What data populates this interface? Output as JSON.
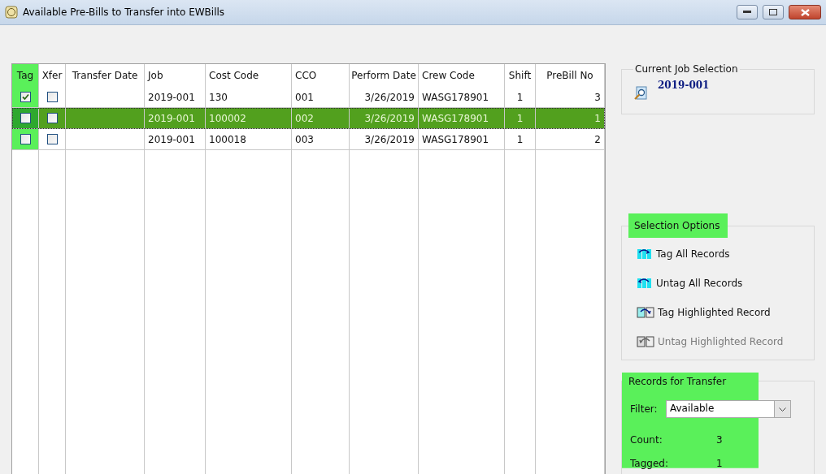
{
  "window": {
    "title": "Available Pre-Bills to Transfer into EWBills"
  },
  "grid": {
    "columns": [
      {
        "label": "Tag",
        "highlighted": true
      },
      {
        "label": "Xfer",
        "highlighted": false
      },
      {
        "label": "Transfer Date",
        "highlighted": false
      },
      {
        "label": "Job",
        "highlighted": false
      },
      {
        "label": "Cost Code",
        "highlighted": false
      },
      {
        "label": "CCO",
        "highlighted": false
      },
      {
        "label": "Perform Date",
        "highlighted": false
      },
      {
        "label": "Crew Code",
        "highlighted": false
      },
      {
        "label": "Shift",
        "highlighted": false
      },
      {
        "label": "PreBill No",
        "highlighted": false
      }
    ],
    "rows": [
      {
        "tag": true,
        "xfer": false,
        "selected": false,
        "cells": [
          "",
          "",
          "",
          "2019-001",
          "130",
          "001",
          "3/26/2019",
          "WASG178901",
          "1",
          "3"
        ]
      },
      {
        "tag": false,
        "xfer": false,
        "selected": true,
        "cells": [
          "",
          "",
          "",
          "2019-001",
          "100002",
          "002",
          "3/26/2019",
          "WASG178901",
          "1",
          "1"
        ]
      },
      {
        "tag": false,
        "xfer": false,
        "selected": false,
        "cells": [
          "",
          "",
          "",
          "2019-001",
          "100018",
          "003",
          "3/26/2019",
          "WASG178901",
          "1",
          "2"
        ]
      }
    ]
  },
  "current_job": {
    "title": "Current Job Selection",
    "value": "2019-001"
  },
  "selection_options": {
    "title": "Selection Options",
    "highlighted": true,
    "items": [
      {
        "label": "Tag All Records",
        "kind": "tag_all",
        "disabled": false
      },
      {
        "label": "Untag All Records",
        "kind": "untag_all",
        "disabled": false
      },
      {
        "label": "Tag Highlighted Record",
        "kind": "tag_one",
        "disabled": false
      },
      {
        "label": "Untag Highlighted Record",
        "kind": "untag_one",
        "disabled": true
      }
    ]
  },
  "records_for_transfer": {
    "title": "Records for Transfer",
    "highlighted": true,
    "filter_label": "Filter:",
    "filter_value": "Available",
    "count_label": "Count:",
    "count": "3",
    "tagged_label": "Tagged:",
    "tagged": "1"
  }
}
